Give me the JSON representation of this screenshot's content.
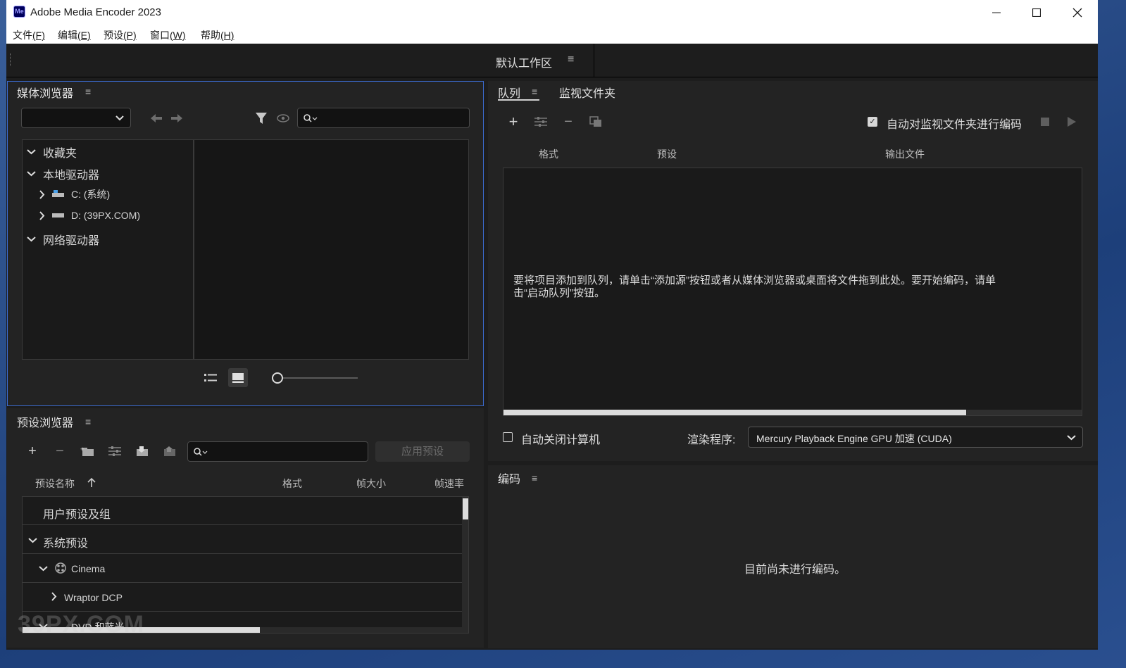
{
  "window": {
    "icon_text": "Me",
    "title": "Adobe Media Encoder 2023",
    "controls": [
      "minimize",
      "maximize",
      "close"
    ]
  },
  "menu": [
    {
      "label": "文件",
      "key": "(F)"
    },
    {
      "label": "编辑",
      "key": "(E)"
    },
    {
      "label": "预设",
      "key": "(P)"
    },
    {
      "label": "窗口",
      "key": "(W)"
    },
    {
      "label": "帮助",
      "key": "(H)"
    }
  ],
  "workspace": {
    "label": "默认工作区",
    "menu_icon": "≡"
  },
  "media_browser": {
    "title": "媒体浏览器",
    "tree": [
      {
        "label": "收藏夹",
        "expanded": true
      },
      {
        "label": "本地驱动器",
        "expanded": true
      },
      {
        "label": "C: (系统)",
        "expanded": false
      },
      {
        "label": "D: (39PX.COM)",
        "expanded": false
      },
      {
        "label": "网络驱动器",
        "expanded": true
      }
    ]
  },
  "preset_browser": {
    "title": "预设浏览器",
    "apply_label": "应用预设",
    "columns": {
      "name": "预设名称",
      "format": "格式",
      "frame_size": "帧大小",
      "frame_rate": "帧速率"
    },
    "rows": [
      {
        "label": "用户预设及组"
      },
      {
        "label": "系统预设"
      },
      {
        "label": "Cinema"
      },
      {
        "label": "Wraptor DCP"
      },
      {
        "label": "DVD 和蓝光"
      }
    ]
  },
  "queue": {
    "tab_queue": "队列",
    "tab_watch": "监视文件夹",
    "auto_encode_label": "自动对监视文件夹进行编码",
    "auto_encode_checked": true,
    "columns": {
      "format": "格式",
      "preset": "预设",
      "output": "输出文件"
    },
    "empty_message_line1": "要将项目添加到队列，请单击“添加源”按钮或者从媒体浏览器或桌面将文件拖到此处。要开始编码，请单",
    "empty_message_line2": "击“启动队列”按钮。",
    "shutdown_label": "自动关闭计算机",
    "shutdown_checked": false,
    "renderer_label": "渲染程序:",
    "renderer_value": "Mercury Playback Engine GPU 加速 (CUDA)",
    "scroll_position": 0.8
  },
  "encoding": {
    "title": "编码",
    "empty_message": "目前尚未进行编码。"
  },
  "watermark": "39PX.COM"
}
